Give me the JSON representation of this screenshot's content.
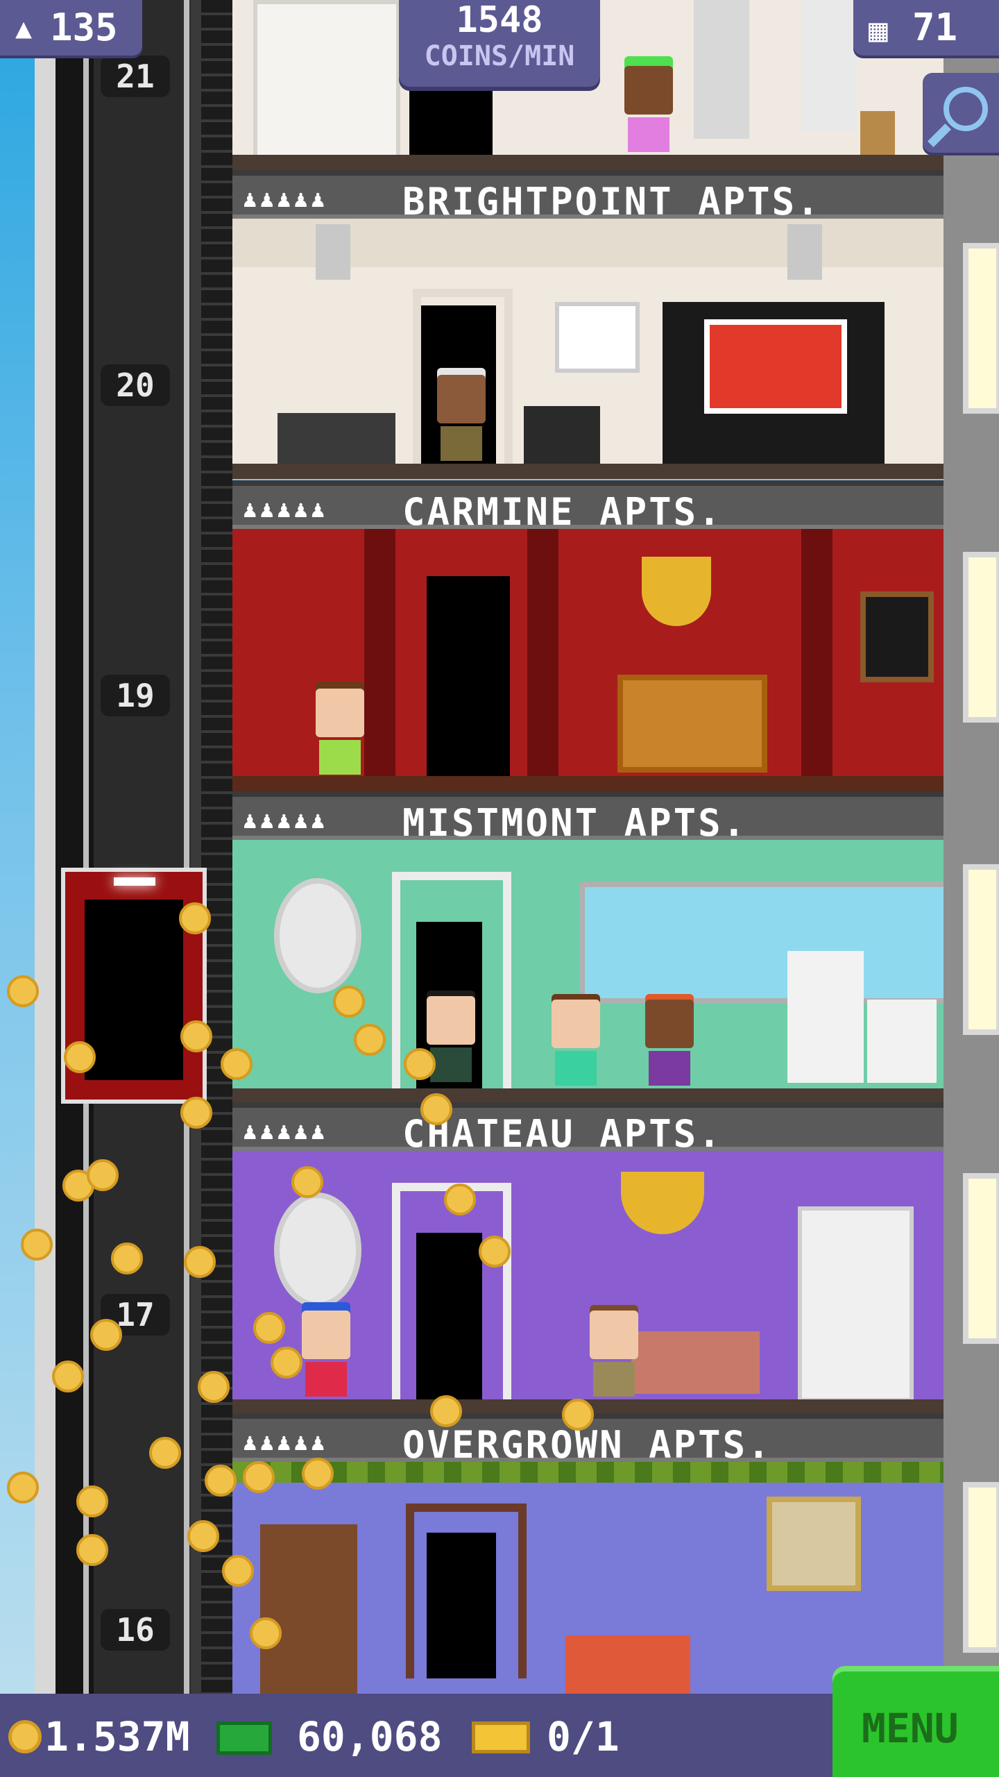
{
  "hud": {
    "population": "135",
    "coins_per_min_value": "1548",
    "coins_per_min_unit": "COINS/MIN",
    "floor_count": "71",
    "population_icon": "person-up-icon",
    "floors_icon": "building-icon",
    "zoom_icon": "magnifier-icon"
  },
  "elevator": {
    "floor_numbers": [
      "21",
      "20",
      "19",
      "17",
      "16"
    ]
  },
  "floors": [
    {
      "label": "BRIGHTPOINT APTS.",
      "dots": "♟♟♟♟♟"
    },
    {
      "label": "CARMINE APTS.",
      "dots": "♟♟♟♟♟"
    },
    {
      "label": "MISTMONT APTS.",
      "dots": "♟♟♟♟♟"
    },
    {
      "label": "CHATEAU APTS.",
      "dots": "♟♟♟♟♟"
    },
    {
      "label": "OVERGROWN APTS.",
      "dots": "♟♟♟♟♟"
    }
  ],
  "bottom_bar": {
    "coins": "1.537M",
    "tower_bux": "60,068",
    "tickets": "0/1",
    "menu_label": "MENU"
  },
  "colors": {
    "hud_bg": "#5c5a93",
    "menu_green": "#2cc42c",
    "coin_gold": "#f0c24a"
  }
}
